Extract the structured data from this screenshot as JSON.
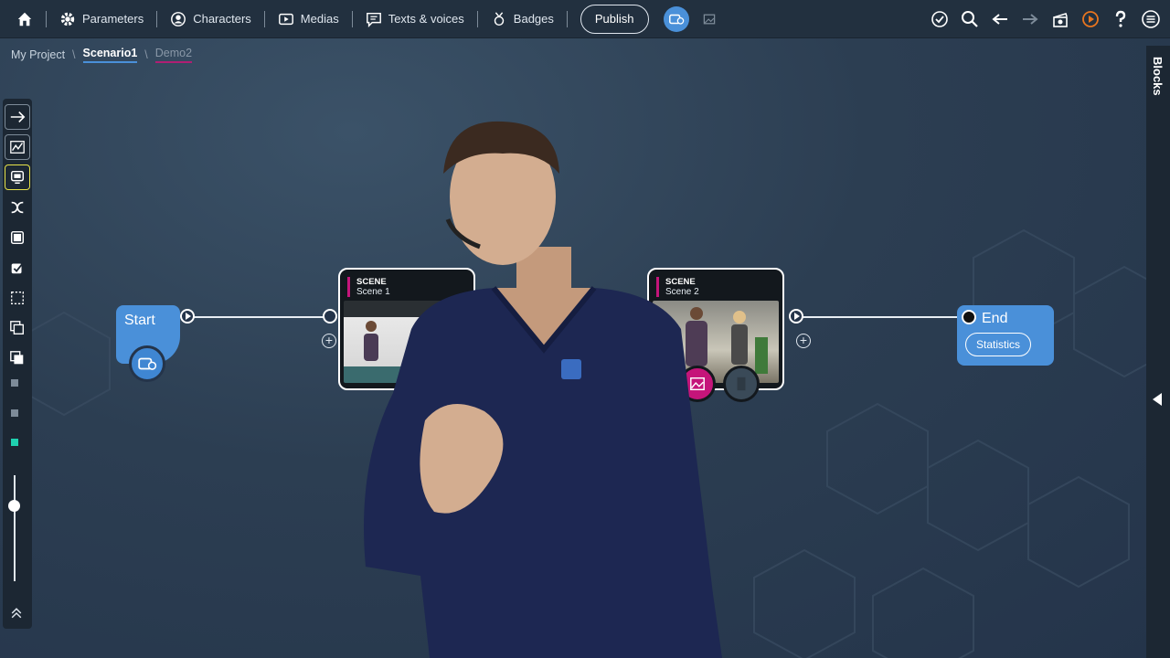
{
  "nav": {
    "home": "home-icon",
    "items": [
      {
        "label": "Parameters",
        "icon": "gear-icon"
      },
      {
        "label": "Characters",
        "icon": "character-icon"
      },
      {
        "label": "Medias",
        "icon": "media-icon"
      },
      {
        "label": "Texts & voices",
        "icon": "texts-icon"
      },
      {
        "label": "Badges",
        "icon": "badge-icon"
      }
    ],
    "publish": "Publish"
  },
  "breadcrumb": {
    "root": "My Project",
    "sep": "\\",
    "current": "Scenario1",
    "sub": "Demo2"
  },
  "right_panel": {
    "label": "Blocks"
  },
  "graph": {
    "start": {
      "label": "Start"
    },
    "scene1": {
      "tag": "SCENE",
      "name": "Scene 1"
    },
    "scene2": {
      "tag": "SCENE",
      "name": "Scene 2"
    },
    "end": {
      "label": "End",
      "button": "Statistics"
    }
  },
  "colors": {
    "accent": "#4a90d9",
    "scene_marker": "#c5157a",
    "selected_tool": "#e7e34a",
    "play_orange": "#e8751f"
  }
}
